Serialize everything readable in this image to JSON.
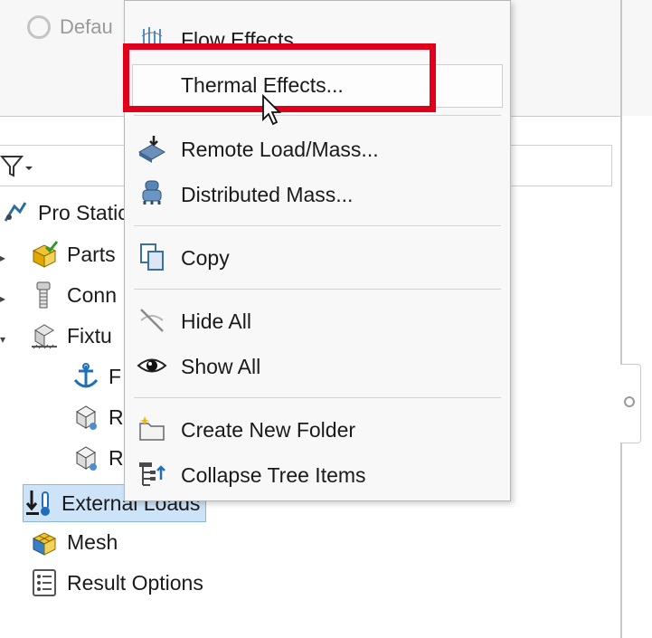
{
  "background": {
    "default_label": "Defau"
  },
  "tree": {
    "root_label": "Pro Static",
    "items": [
      {
        "label": "Parts",
        "icon": "parts-icon"
      },
      {
        "label": "Conn",
        "icon": "connections-icon"
      },
      {
        "label": "Fixtu",
        "icon": "fixtures-icon"
      },
      {
        "label": "F",
        "icon": "fixed-geometry-icon"
      },
      {
        "label": "R",
        "icon": "roller-icon"
      },
      {
        "label": "R",
        "icon": "roller-icon"
      },
      {
        "label": "External Loads",
        "icon": "external-loads-icon",
        "selected": true
      },
      {
        "label": "Mesh",
        "icon": "mesh-icon"
      },
      {
        "label": "Result Options",
        "icon": "result-options-icon"
      }
    ]
  },
  "context_menu": {
    "items": [
      {
        "label": "Flow Effects",
        "icon": "flow-effects-icon"
      },
      {
        "label": "Thermal Effects...",
        "icon": "",
        "highlighted": true
      },
      {
        "label": "Remote Load/Mass...",
        "icon": "remote-load-icon"
      },
      {
        "label": "Distributed Mass...",
        "icon": "distributed-mass-icon"
      },
      {
        "label": "Copy",
        "icon": "copy-icon"
      },
      {
        "label": "Hide All",
        "icon": "hide-icon"
      },
      {
        "label": "Show All",
        "icon": "eye-icon"
      },
      {
        "label": "Create New Folder",
        "icon": "new-folder-icon"
      },
      {
        "label": "Collapse Tree Items",
        "icon": "collapse-tree-icon"
      }
    ]
  },
  "colors": {
    "highlight_border": "#e0001b",
    "selection_bg": "#cde3f7"
  }
}
